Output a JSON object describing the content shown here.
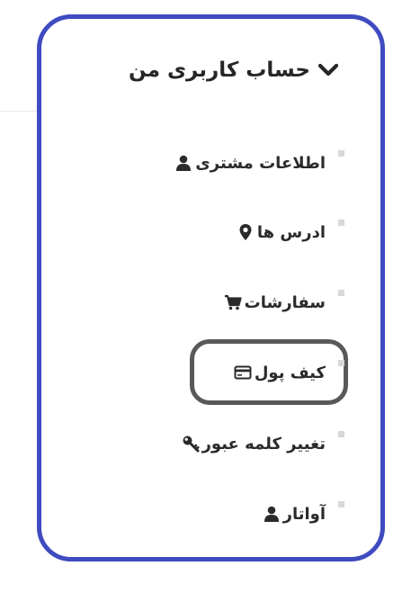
{
  "account": {
    "title": "حساب کاربری من",
    "toggle_icon": "chevron-down-icon"
  },
  "menu": {
    "items": [
      {
        "label": "اطلاعات مشتری",
        "icon": "user-icon"
      },
      {
        "label": "ادرس ها",
        "icon": "map-marker-icon"
      },
      {
        "label": "سفارشات",
        "icon": "shopping-cart-icon"
      },
      {
        "label": "کیف پول",
        "icon": "credit-card-icon"
      },
      {
        "label": "تغییر کلمه عبور",
        "icon": "key-icon"
      },
      {
        "label": "آواتار",
        "icon": "user-icon"
      }
    ]
  },
  "colors": {
    "panel_border": "#3f4bc0",
    "highlight_border": "#595959",
    "text": "#2b2b2b",
    "bullet": "#d8d8d8"
  }
}
